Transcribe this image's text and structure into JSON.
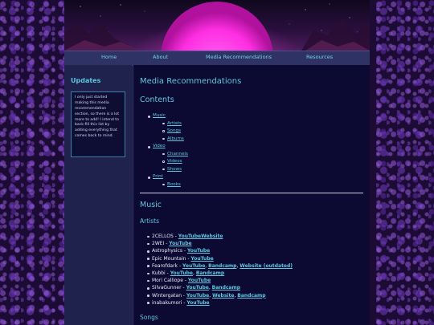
{
  "nav": {
    "items": [
      "Home",
      "About",
      "Media Recommendations",
      "Resources"
    ]
  },
  "sidebar": {
    "title": "Updates",
    "note": "I only just started making this media recommendation section, so there is a lot more to add! I intend to back-fill this list by adding everything that comes back to mind."
  },
  "main": {
    "title": "Media Recommendations",
    "contents_heading": "Contents",
    "toc": {
      "music": "Music",
      "artists": "Artists",
      "songs": "Songs",
      "albums": "Albums",
      "video": "Video",
      "channels": "Channels",
      "videos": "Videos",
      "shows": "Shows",
      "print": "Print",
      "books": "Books"
    },
    "music_heading": "Music",
    "artists_heading": "Artists",
    "songs_heading": "Songs",
    "artists": [
      {
        "name": "2CELLOS",
        "sep": " - ",
        "links": [
          "YouTube",
          "Website"
        ],
        "joiner": ""
      },
      {
        "name": "2WEI",
        "sep": " - ",
        "links": [
          "YouTube"
        ],
        "joiner": ""
      },
      {
        "name": "Astrophysics",
        "sep": " - ",
        "links": [
          "YouTube"
        ],
        "joiner": ""
      },
      {
        "name": "Epic Mountain",
        "sep": " - ",
        "links": [
          "YouTube"
        ],
        "joiner": ""
      },
      {
        "name": "Fearofdark",
        "sep": " - ",
        "links": [
          "YouTube",
          "Bandcamp",
          "Website (outdated)"
        ],
        "joiner": ", "
      },
      {
        "name": "Kubbi",
        "sep": " - ",
        "links": [
          "YouTube",
          "Bandcamp"
        ],
        "joiner": ", "
      },
      {
        "name": "Mori Calliope",
        "sep": " - ",
        "links": [
          "YouTube"
        ],
        "joiner": ""
      },
      {
        "name": "SilvaGunner",
        "sep": " - ",
        "links": [
          "YouTube",
          "Bandcamp"
        ],
        "joiner": ", "
      },
      {
        "name": "Wintergatan",
        "sep": " - ",
        "links": [
          "YouTube",
          "Website",
          "Bandcamp"
        ],
        "joiner": ", "
      },
      {
        "name": "inabakumori",
        "sep": " - ",
        "links": [
          "YouTube"
        ],
        "joiner": ""
      }
    ]
  }
}
